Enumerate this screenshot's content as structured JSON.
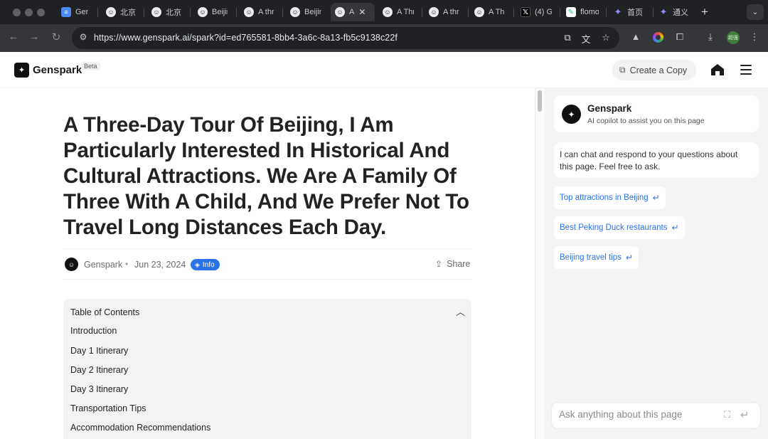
{
  "browser": {
    "tabs": [
      {
        "title": "Gens",
        "favicon": "doc-icon"
      },
      {
        "title": "北京三",
        "favicon": "genspark-icon"
      },
      {
        "title": "北京三",
        "favicon": "genspark-icon"
      },
      {
        "title": "Beijin",
        "favicon": "genspark-icon"
      },
      {
        "title": "A thre",
        "favicon": "genspark-icon"
      },
      {
        "title": "Beijin",
        "favicon": "genspark-icon"
      },
      {
        "title": "A",
        "favicon": "genspark-icon",
        "active": true
      },
      {
        "title": "A Thr",
        "favicon": "genspark-icon"
      },
      {
        "title": "A thr",
        "favicon": "genspark-icon"
      },
      {
        "title": "A Th",
        "favicon": "genspark-icon"
      },
      {
        "title": "(4) G",
        "favicon": "x-icon"
      },
      {
        "title": "flomo",
        "favicon": "flomo-icon"
      },
      {
        "title": "首页",
        "favicon": "star-icon"
      },
      {
        "title": "通义",
        "favicon": "star-icon"
      }
    ],
    "close_tab_glyph": "✕",
    "new_tab_glyph": "+",
    "url": "https://www.genspark.ai/spark?id=ed765581-8bb4-3a6c-8a13-fb5c9138c22f",
    "profile_label": "超强"
  },
  "header": {
    "brand": "Genspark",
    "beta": "Beta",
    "create_copy": "Create a Copy"
  },
  "article": {
    "title": "A Three-Day Tour Of Beijing, I Am Particularly Interested In Historical And Cultural Attractions. We Are A Family Of Three With A Child, And We Prefer Not To Travel Long Distances Each Day.",
    "author": "Genspark",
    "separator": "•",
    "date": "Jun 23, 2024",
    "info_badge": "Info",
    "share": "Share",
    "toc": {
      "title": "Table of Contents",
      "items": [
        "Introduction",
        "Day 1 Itinerary",
        "Day 2 Itinerary",
        "Day 3 Itinerary",
        "Transportation Tips",
        "Accommodation Recommendations"
      ]
    }
  },
  "copilot": {
    "name": "Genspark",
    "subtitle": "AI copilot to assist you on this page",
    "message": "I can chat and respond to your questions about this page. Feel free to ask.",
    "suggestions": [
      "Top attractions in Beijing",
      "Best Peking Duck restaurants",
      "Beijing travel tips"
    ],
    "input_placeholder": "Ask anything about this page"
  },
  "colors": {
    "accent": "#2a72e8",
    "tabbar_bg": "#202124",
    "toolbar_bg": "#35363a",
    "panel_bg": "#f4f4f4"
  }
}
